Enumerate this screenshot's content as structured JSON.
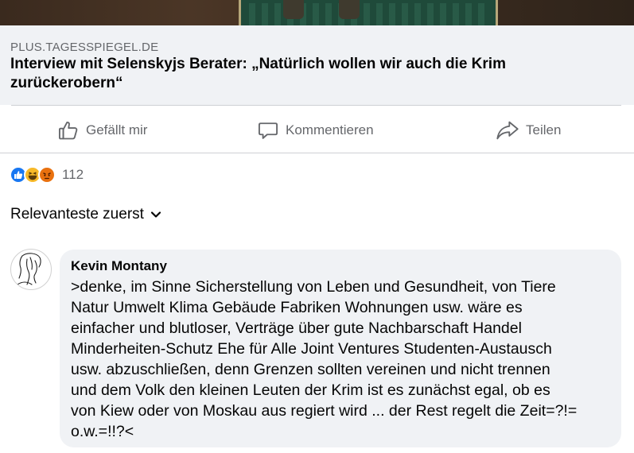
{
  "link_preview": {
    "domain": "PLUS.TAGESSPIEGEL.DE",
    "headline": "Interview mit Selenskyjs Berater: „Natürlich wollen wir auch die Krim zurückerobern“"
  },
  "actions": {
    "like_label": "Gefällt mir",
    "comment_label": "Kommentieren",
    "share_label": "Teilen"
  },
  "reactions": {
    "types": [
      "like-icon",
      "haha-icon",
      "angry-icon"
    ],
    "count": "112"
  },
  "sort": {
    "label": "Relevanteste zuerst"
  },
  "comments": [
    {
      "author": "Kevin Montany",
      "text": ">denke, im Sinne Sicherstellung von Leben und Gesundheit, von Tiere\nNatur Umwelt Klima Gebäude Fabriken Wohnungen usw. wäre es\neinfacher und blutloser, Verträge über gute Nachbarschaft Handel\nMinderheiten-Schutz Ehe für Alle Joint Ventures Studenten-Austausch\nusw. abzuschließen, denn Grenzen sollten vereinen und nicht trennen\nund dem Volk den kleinen Leuten der Krim ist es zunächst  egal, ob es\nvon Kiew oder von Moskau aus regiert wird ... der Rest regelt die Zeit=?!=\no.w.=!!?<"
    }
  ],
  "colors": {
    "secondary_text": "#65676b",
    "bubble_bg": "#f0f2f5",
    "like_blue": "#1877f2",
    "haha_yellow": "#f7b928",
    "angry_orange": "#e9710f"
  }
}
